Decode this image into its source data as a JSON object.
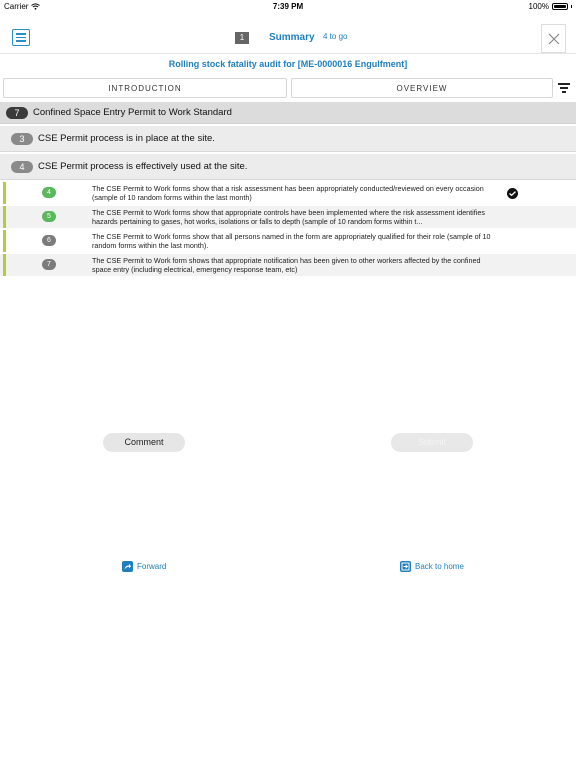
{
  "status_bar": {
    "carrier": "Carrier",
    "time": "7:39 PM",
    "battery": "100%"
  },
  "nav": {
    "page_number": "1",
    "title": "Summary",
    "remaining": "4 to go"
  },
  "audit_title": "Rolling stock fatality audit for [ME-0000016 Engulfment]",
  "tabs": {
    "introduction": "INTRODUCTION",
    "overview": "OVERVIEW"
  },
  "sections": [
    {
      "number": "7",
      "label": "Confined Space Entry Permit to Work Standard"
    },
    {
      "number": "3",
      "label": "CSE Permit process is in place at the site."
    },
    {
      "number": "4",
      "label": "CSE Permit process is effectively used at the site."
    }
  ],
  "items": [
    {
      "number": "4",
      "status": "green",
      "checked": true,
      "text": "The CSE Permit to Work forms show that a risk assessment has been appropriately conducted/reviewed on every occasion (sample of 10 random forms within the last month)"
    },
    {
      "number": "5",
      "status": "green",
      "checked": false,
      "text": "The CSE Permit to Work forms show that appropriate controls have been implemented where the risk assessment identifies hazards pertaining to gases, hot works, isolations or falls to depth (sample of 10 random forms within t..."
    },
    {
      "number": "6",
      "status": "grey",
      "checked": false,
      "text": "The CSE Permit to Work forms show that all persons named in the form are appropriately qualified for their role (sample of 10 random forms within the last month)."
    },
    {
      "number": "7",
      "status": "grey",
      "checked": false,
      "text": "The CSE Permit to Work form shows that appropriate notification has been given to other workers affected by the confined space entry (including electrical, emergency response team, etc)"
    }
  ],
  "buttons": {
    "comment": "Comment",
    "submit": "Submit"
  },
  "footer": {
    "forward": "Forward",
    "back_home": "Back to home"
  },
  "colors": {
    "accent": "#1f7fbd",
    "green": "#5cb85c",
    "indicator": "#b4cc3c"
  }
}
